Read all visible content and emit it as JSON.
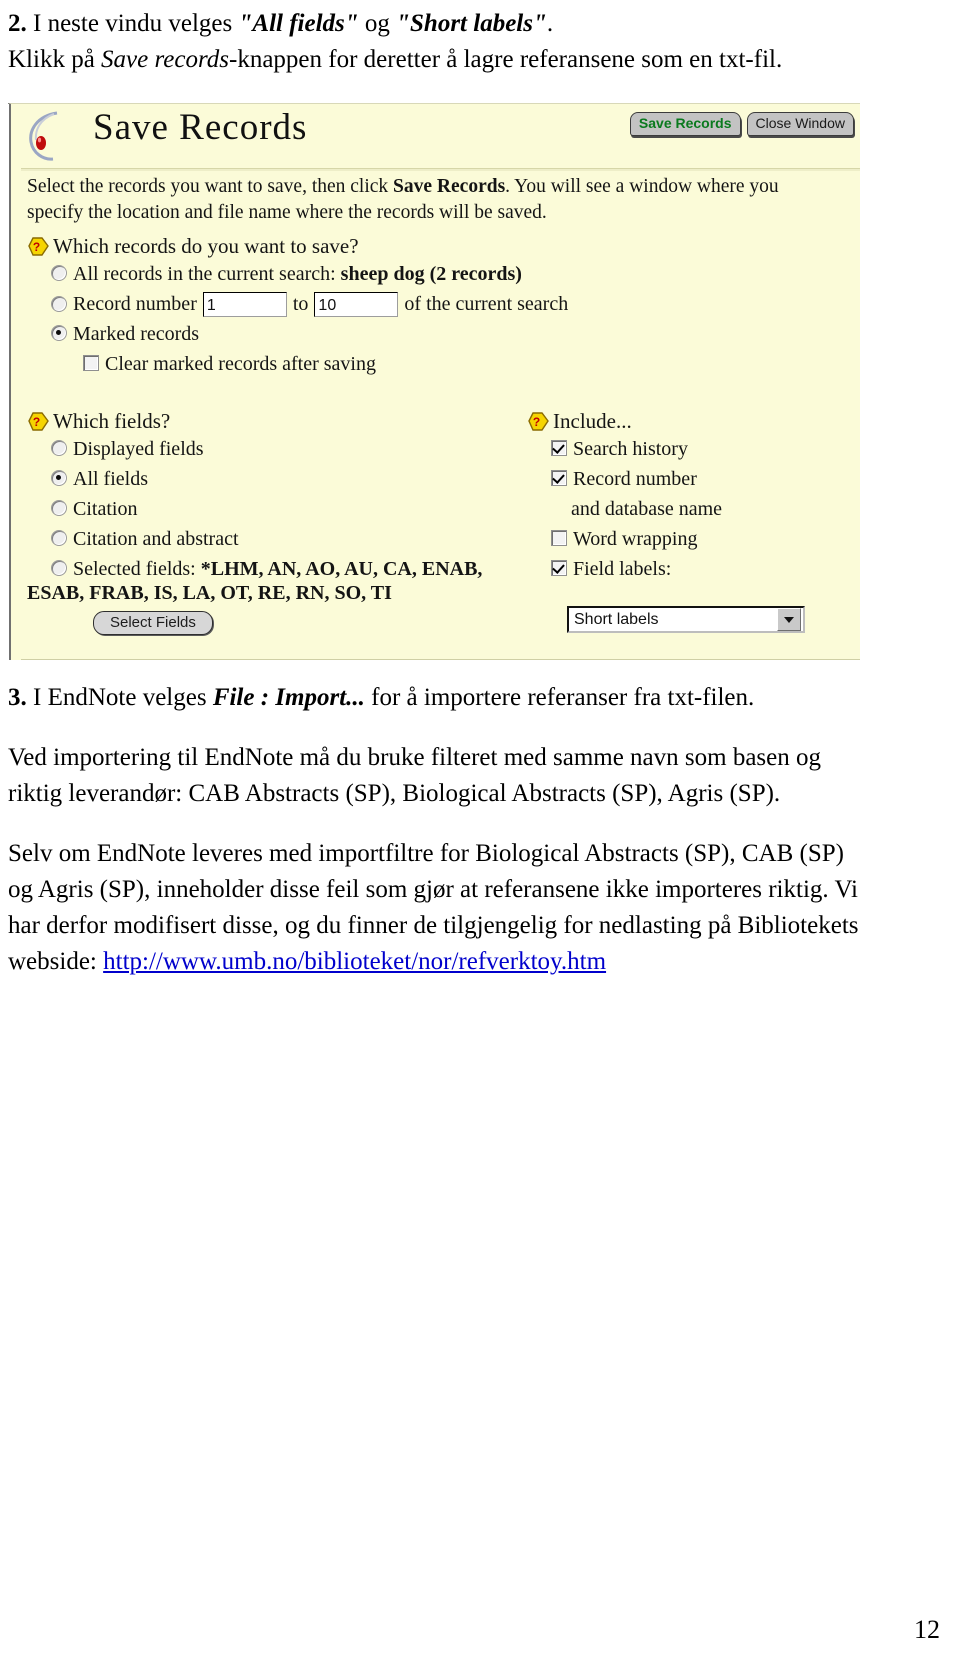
{
  "document": {
    "intro": {
      "step_number": "2.",
      "line1_a": "I neste vindu velges ",
      "line1_b": "\"All fields\"",
      "line1_c": " og ",
      "line1_d": "\"Short labels\"",
      "line1_e": ".",
      "line2_a": "Klikk på ",
      "line2_b": "Save records",
      "line2_c": "-knappen for deretter å lagre referansene som en txt-fil."
    },
    "step3": {
      "number": "3.",
      "a": "I EndNote velges ",
      "b": "File : Import...",
      "c": " for å importere referanser fra txt-filen."
    },
    "paragraph1_line1": "Ved importering til EndNote må du bruke filteret med samme navn som basen og",
    "paragraph1_line2": "riktig leverandør: CAB Abstracts (SP), Biological Abstracts (SP), Agris (SP).",
    "paragraph2_line1": "Selv om EndNote leveres med importfiltre for Biological Abstracts (SP), CAB (SP)",
    "paragraph2_line2": "og Agris (SP), inneholder disse feil som gjør at referansene ikke importeres riktig. Vi",
    "paragraph2_line3": "har derfor modifisert disse, og du finner de tilgjengelig for nedlasting på Bibliotekets",
    "paragraph2_line4_prefix": "webside: ",
    "link_text": "http://www.umb.no/biblioteket/nor/refverktoy.htm",
    "page_number": "12"
  },
  "screenshot": {
    "header": {
      "title": "Save Records",
      "save_button": "Save Records",
      "close_button": "Close Window"
    },
    "blurb_part1": "Select the records you want to save, then click ",
    "blurb_bold": "Save Records",
    "blurb_part2": ". You will see a window where you specify the location and file name where the records will be saved.",
    "which_records": {
      "title": "Which records do you want to save?",
      "option_all_prefix": "All records in the current search: ",
      "option_all_bold": "sheep dog (2 records)",
      "option_all_selected": false,
      "option_range_label_a": "Record number",
      "option_range_from_value": "1",
      "option_range_middle": "to",
      "option_range_to_value": "10",
      "option_range_label_b": "of the current search",
      "option_range_selected": false,
      "option_marked_label": "Marked records",
      "option_marked_selected": true,
      "clear_marked_label": "Clear marked records after saving",
      "clear_marked_checked": false
    },
    "which_fields": {
      "title": "Which fields?",
      "options": [
        {
          "label": "Displayed fields",
          "selected": false
        },
        {
          "label": "All fields",
          "selected": true
        },
        {
          "label": "Citation",
          "selected": false
        },
        {
          "label": "Citation and abstract",
          "selected": false
        }
      ],
      "selected_fields_label": "Selected fields: ",
      "selected_fields_line1": "*LHM, AN, AO, AU, CA, ENAB,",
      "selected_fields_line2": "ESAB, FRAB, IS, LA, OT, RE, RN, SO, TI",
      "selected_fields_selected": false,
      "select_fields_button": "Select Fields"
    },
    "include": {
      "title": "Include...",
      "items": [
        {
          "label": "Search history",
          "checked": true
        },
        {
          "label": "Record number",
          "checked": true
        },
        {
          "label": "Word wrapping",
          "checked": false
        },
        {
          "label": "Field labels:",
          "checked": true
        }
      ],
      "record_number_sub": "and database name",
      "field_labels_value": "Short labels"
    },
    "colors": {
      "panel_background": "#fbfbd8",
      "save_button_text": "#0a7a1e",
      "link": "#0000cc"
    }
  }
}
